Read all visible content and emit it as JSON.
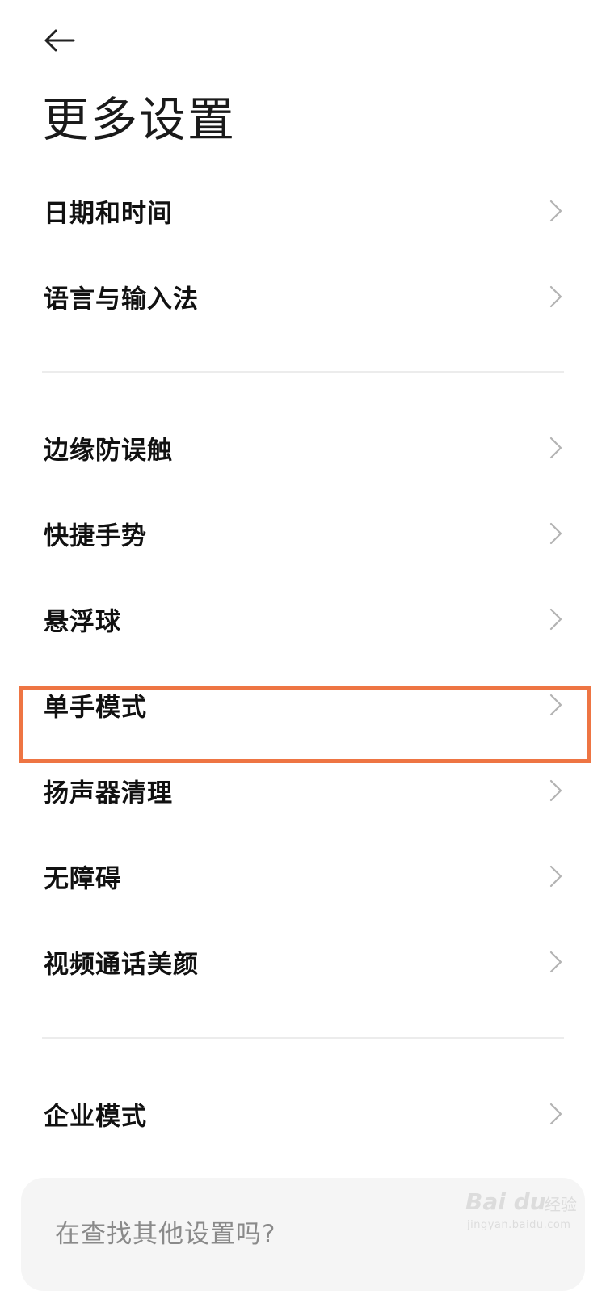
{
  "header": {
    "back_icon": "arrow-left-icon",
    "title": "更多设置"
  },
  "groups": [
    {
      "items": [
        {
          "label": "日期和时间",
          "icon": "chevron-right-icon"
        },
        {
          "label": "语言与输入法",
          "icon": "chevron-right-icon"
        }
      ]
    },
    {
      "items": [
        {
          "label": "边缘防误触",
          "icon": "chevron-right-icon"
        },
        {
          "label": "快捷手势",
          "icon": "chevron-right-icon"
        },
        {
          "label": "悬浮球",
          "icon": "chevron-right-icon"
        },
        {
          "label": "单手模式",
          "icon": "chevron-right-icon",
          "highlighted": true
        },
        {
          "label": "扬声器清理",
          "icon": "chevron-right-icon"
        },
        {
          "label": "无障碍",
          "icon": "chevron-right-icon"
        },
        {
          "label": "视频通话美颜",
          "icon": "chevron-right-icon"
        }
      ]
    },
    {
      "items": [
        {
          "label": "企业模式",
          "icon": "chevron-right-icon"
        }
      ]
    }
  ],
  "search_card": {
    "text": "在查找其他设置吗?"
  },
  "watermark": {
    "brand": "Bai du",
    "sub": "经验",
    "url": "jingyan.baidu.com"
  },
  "colors": {
    "highlight": "#ee7543",
    "divider": "#ececec",
    "card_bg": "#f5f5f5"
  }
}
